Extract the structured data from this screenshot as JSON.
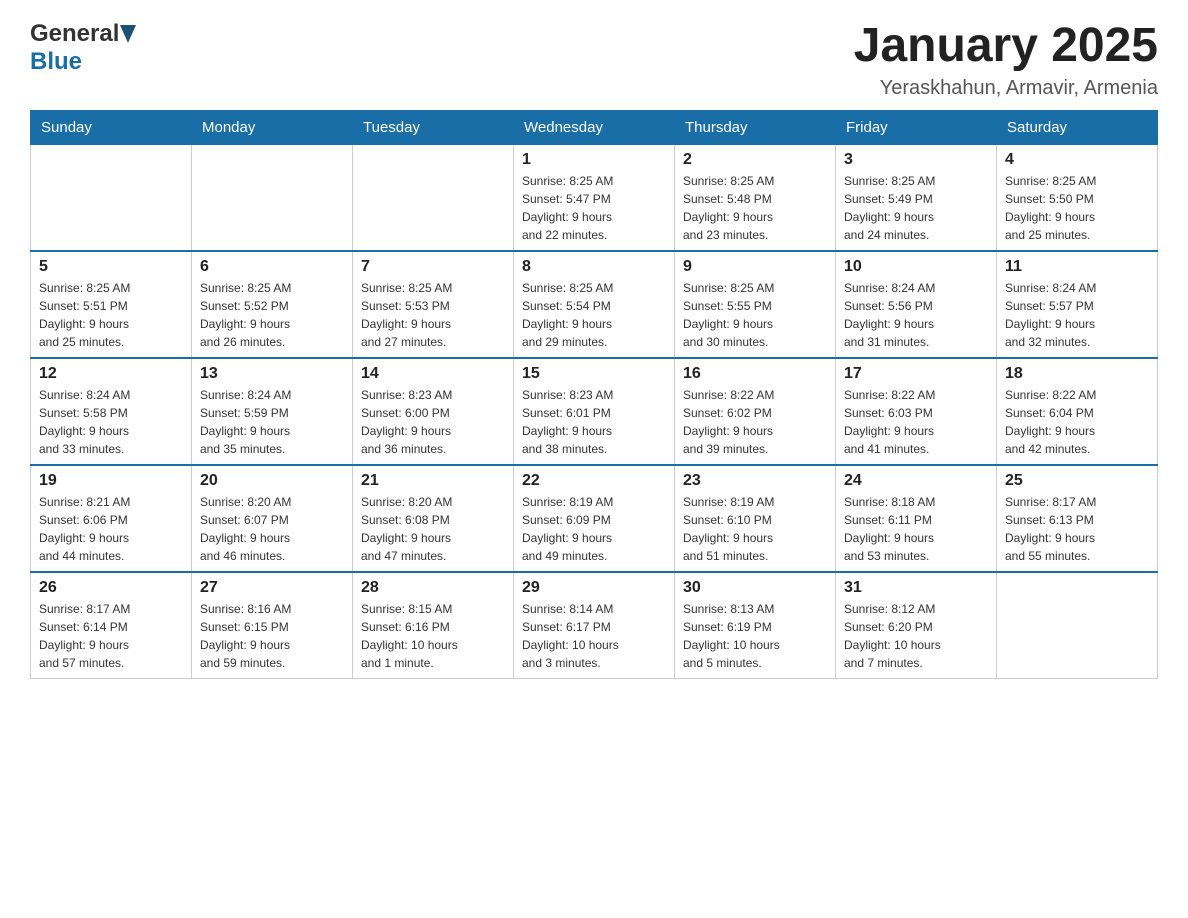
{
  "header": {
    "logo_general": "General",
    "logo_blue": "Blue",
    "title": "January 2025",
    "subtitle": "Yeraskhahun, Armavir, Armenia"
  },
  "weekdays": [
    "Sunday",
    "Monday",
    "Tuesday",
    "Wednesday",
    "Thursday",
    "Friday",
    "Saturday"
  ],
  "weeks": [
    [
      {
        "day": "",
        "info": ""
      },
      {
        "day": "",
        "info": ""
      },
      {
        "day": "",
        "info": ""
      },
      {
        "day": "1",
        "info": "Sunrise: 8:25 AM\nSunset: 5:47 PM\nDaylight: 9 hours\nand 22 minutes."
      },
      {
        "day": "2",
        "info": "Sunrise: 8:25 AM\nSunset: 5:48 PM\nDaylight: 9 hours\nand 23 minutes."
      },
      {
        "day": "3",
        "info": "Sunrise: 8:25 AM\nSunset: 5:49 PM\nDaylight: 9 hours\nand 24 minutes."
      },
      {
        "day": "4",
        "info": "Sunrise: 8:25 AM\nSunset: 5:50 PM\nDaylight: 9 hours\nand 25 minutes."
      }
    ],
    [
      {
        "day": "5",
        "info": "Sunrise: 8:25 AM\nSunset: 5:51 PM\nDaylight: 9 hours\nand 25 minutes."
      },
      {
        "day": "6",
        "info": "Sunrise: 8:25 AM\nSunset: 5:52 PM\nDaylight: 9 hours\nand 26 minutes."
      },
      {
        "day": "7",
        "info": "Sunrise: 8:25 AM\nSunset: 5:53 PM\nDaylight: 9 hours\nand 27 minutes."
      },
      {
        "day": "8",
        "info": "Sunrise: 8:25 AM\nSunset: 5:54 PM\nDaylight: 9 hours\nand 29 minutes."
      },
      {
        "day": "9",
        "info": "Sunrise: 8:25 AM\nSunset: 5:55 PM\nDaylight: 9 hours\nand 30 minutes."
      },
      {
        "day": "10",
        "info": "Sunrise: 8:24 AM\nSunset: 5:56 PM\nDaylight: 9 hours\nand 31 minutes."
      },
      {
        "day": "11",
        "info": "Sunrise: 8:24 AM\nSunset: 5:57 PM\nDaylight: 9 hours\nand 32 minutes."
      }
    ],
    [
      {
        "day": "12",
        "info": "Sunrise: 8:24 AM\nSunset: 5:58 PM\nDaylight: 9 hours\nand 33 minutes."
      },
      {
        "day": "13",
        "info": "Sunrise: 8:24 AM\nSunset: 5:59 PM\nDaylight: 9 hours\nand 35 minutes."
      },
      {
        "day": "14",
        "info": "Sunrise: 8:23 AM\nSunset: 6:00 PM\nDaylight: 9 hours\nand 36 minutes."
      },
      {
        "day": "15",
        "info": "Sunrise: 8:23 AM\nSunset: 6:01 PM\nDaylight: 9 hours\nand 38 minutes."
      },
      {
        "day": "16",
        "info": "Sunrise: 8:22 AM\nSunset: 6:02 PM\nDaylight: 9 hours\nand 39 minutes."
      },
      {
        "day": "17",
        "info": "Sunrise: 8:22 AM\nSunset: 6:03 PM\nDaylight: 9 hours\nand 41 minutes."
      },
      {
        "day": "18",
        "info": "Sunrise: 8:22 AM\nSunset: 6:04 PM\nDaylight: 9 hours\nand 42 minutes."
      }
    ],
    [
      {
        "day": "19",
        "info": "Sunrise: 8:21 AM\nSunset: 6:06 PM\nDaylight: 9 hours\nand 44 minutes."
      },
      {
        "day": "20",
        "info": "Sunrise: 8:20 AM\nSunset: 6:07 PM\nDaylight: 9 hours\nand 46 minutes."
      },
      {
        "day": "21",
        "info": "Sunrise: 8:20 AM\nSunset: 6:08 PM\nDaylight: 9 hours\nand 47 minutes."
      },
      {
        "day": "22",
        "info": "Sunrise: 8:19 AM\nSunset: 6:09 PM\nDaylight: 9 hours\nand 49 minutes."
      },
      {
        "day": "23",
        "info": "Sunrise: 8:19 AM\nSunset: 6:10 PM\nDaylight: 9 hours\nand 51 minutes."
      },
      {
        "day": "24",
        "info": "Sunrise: 8:18 AM\nSunset: 6:11 PM\nDaylight: 9 hours\nand 53 minutes."
      },
      {
        "day": "25",
        "info": "Sunrise: 8:17 AM\nSunset: 6:13 PM\nDaylight: 9 hours\nand 55 minutes."
      }
    ],
    [
      {
        "day": "26",
        "info": "Sunrise: 8:17 AM\nSunset: 6:14 PM\nDaylight: 9 hours\nand 57 minutes."
      },
      {
        "day": "27",
        "info": "Sunrise: 8:16 AM\nSunset: 6:15 PM\nDaylight: 9 hours\nand 59 minutes."
      },
      {
        "day": "28",
        "info": "Sunrise: 8:15 AM\nSunset: 6:16 PM\nDaylight: 10 hours\nand 1 minute."
      },
      {
        "day": "29",
        "info": "Sunrise: 8:14 AM\nSunset: 6:17 PM\nDaylight: 10 hours\nand 3 minutes."
      },
      {
        "day": "30",
        "info": "Sunrise: 8:13 AM\nSunset: 6:19 PM\nDaylight: 10 hours\nand 5 minutes."
      },
      {
        "day": "31",
        "info": "Sunrise: 8:12 AM\nSunset: 6:20 PM\nDaylight: 10 hours\nand 7 minutes."
      },
      {
        "day": "",
        "info": ""
      }
    ]
  ]
}
